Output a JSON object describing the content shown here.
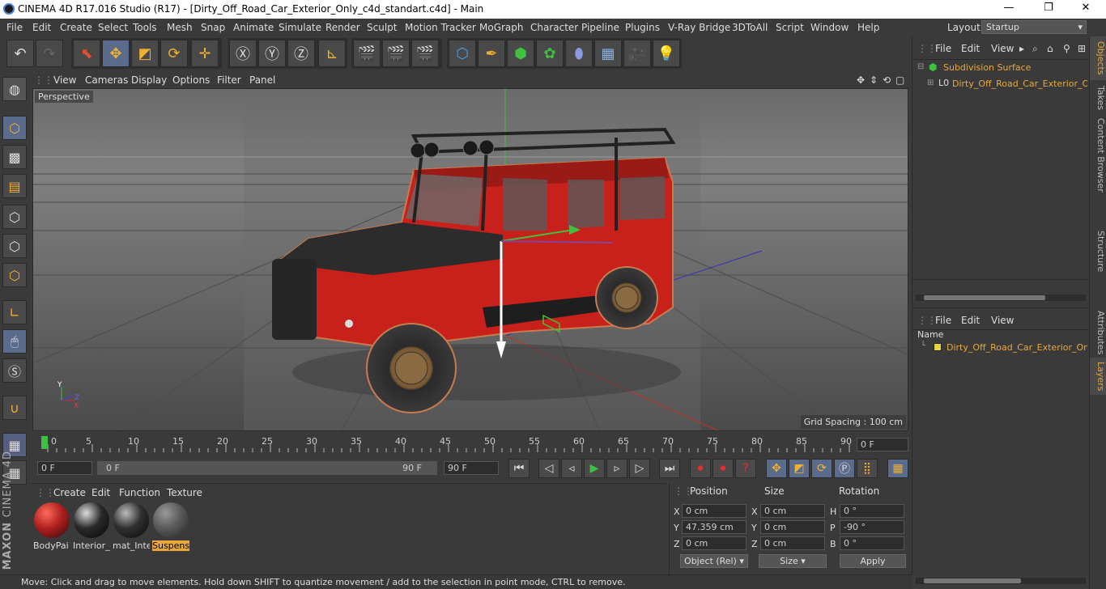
{
  "title_bar": {
    "title": "CINEMA 4D R17.016 Studio (R17) - [Dirty_Off_Road_Car_Exterior_Only_c4d_standart.c4d] - Main",
    "minimize": "—",
    "maximize": "❐",
    "close": "✕"
  },
  "menu": {
    "items": [
      "File",
      "Edit",
      "Create",
      "Select",
      "Tools",
      "Mesh",
      "Snap",
      "Animate",
      "Simulate",
      "Render",
      "Sculpt",
      "Motion Tracker",
      "MoGraph",
      "Character",
      "Pipeline",
      "Plugins",
      "V-Ray Bridge",
      "3DToAll",
      "Script",
      "Window",
      "Help"
    ],
    "layout_label": "Layout:",
    "layout_value": "Startup"
  },
  "viewport": {
    "menu": [
      "View",
      "Cameras",
      "Display",
      "Options",
      "Filter",
      "Panel"
    ],
    "camera_label": "Perspective",
    "grid_spacing": "Grid Spacing : 100 cm"
  },
  "timeline": {
    "ticks": [
      "0",
      "5",
      "10",
      "15",
      "20",
      "25",
      "30",
      "35",
      "40",
      "45",
      "50",
      "55",
      "60",
      "65",
      "70",
      "75",
      "80",
      "85",
      "90"
    ],
    "current_frame": "0 F"
  },
  "transport": {
    "start": "0 F",
    "range_start": "0 F",
    "range_end": "90 F",
    "end": "90 F"
  },
  "materials": {
    "menu": [
      "Create",
      "Edit",
      "Function",
      "Texture"
    ],
    "items": [
      {
        "name": "BodyPai",
        "color": "#b02020"
      },
      {
        "name": "Interior_",
        "color": "#2a2a2a"
      },
      {
        "name": "mat_Inte",
        "color": "#303030"
      },
      {
        "name": "Suspens",
        "color": "#5a5a5a",
        "selected": true
      }
    ]
  },
  "coords": {
    "headers": {
      "position": "Position",
      "size": "Size",
      "rotation": "Rotation"
    },
    "rows": [
      {
        "axis": "X",
        "pos": "0 cm",
        "saxis": "X",
        "size": "0 cm",
        "raxis": "H",
        "rot": "0 °"
      },
      {
        "axis": "Y",
        "pos": "47.359 cm",
        "saxis": "Y",
        "size": "0 cm",
        "raxis": "P",
        "rot": "-90 °"
      },
      {
        "axis": "Z",
        "pos": "0 cm",
        "saxis": "Z",
        "size": "0 cm",
        "raxis": "B",
        "rot": "0 °"
      }
    ],
    "mode": "Object (Rel)",
    "size_mode": "Size",
    "apply": "Apply"
  },
  "status": "Move: Click and drag to move elements. Hold down SHIFT to quantize movement / add to the selection in point mode, CTRL to remove.",
  "objects": {
    "menu": [
      "File",
      "Edit",
      "View"
    ],
    "items": [
      "Subdivision Surface",
      "Dirty_Off_Road_Car_Exterior_Onl"
    ]
  },
  "layers": {
    "menu": [
      "File",
      "Edit",
      "View"
    ],
    "column": "Name",
    "items": [
      "Dirty_Off_Road_Car_Exterior_Only"
    ]
  },
  "side_tabs": {
    "top": [
      "Objects",
      "Takes",
      "Content Browser",
      "Structure"
    ],
    "bottom": [
      "Attributes",
      "Layers"
    ]
  },
  "maxon": {
    "brand": "MAXON",
    "product": "CINEMA 4D"
  },
  "colors": {
    "accent": "#e8a83c",
    "selected_blue": "#5a6b8c",
    "car_red": "#c8211b"
  }
}
